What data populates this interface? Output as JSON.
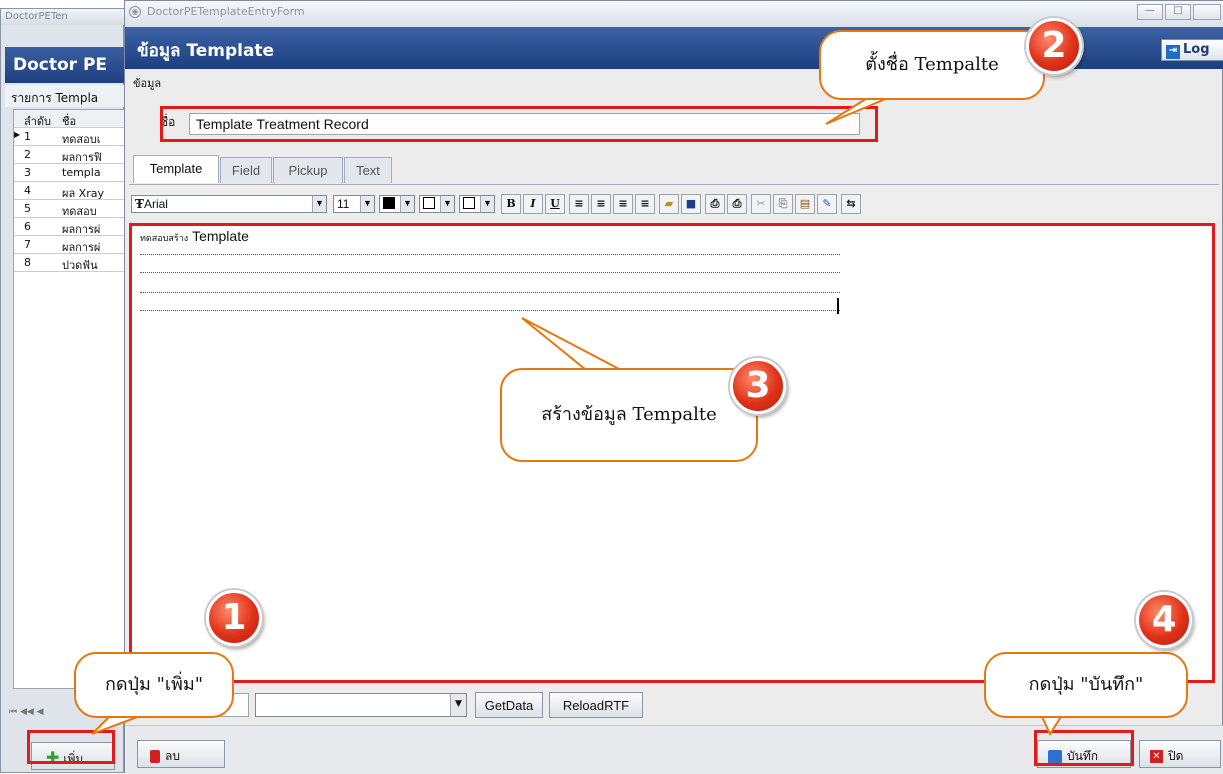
{
  "bg_window": {
    "title": "DoctorPETen",
    "header": "Doctor PE",
    "subheader": "รายการ Templa",
    "columns": [
      "ลำดับ",
      "ชื่อ"
    ],
    "rows": [
      {
        "no": "1",
        "name": "ทดสอบเ"
      },
      {
        "no": "2",
        "name": "ผลการฟิ"
      },
      {
        "no": "3",
        "name": "templa"
      },
      {
        "no": "4",
        "name": "ผล Xray"
      },
      {
        "no": "5",
        "name": "ทดสอบ"
      },
      {
        "no": "6",
        "name": "ผลการผ่"
      },
      {
        "no": "7",
        "name": "ผลการผ่"
      },
      {
        "no": "8",
        "name": "ปวดฟัน"
      }
    ],
    "nav": "⏮ ◀◀ ◀",
    "add_label": "เพิ่ม"
  },
  "window": {
    "title": "DoctorPETemplateEntryForm",
    "header_title": "ข้อมูล Template",
    "logout_label": "Log",
    "section_label": "ข้อมูล"
  },
  "form": {
    "name_label": "ชื่อ",
    "name_value": "Template Treatment Record"
  },
  "tabs": [
    "Template",
    "Field",
    "Pickup",
    "Text"
  ],
  "toolbar": {
    "font": "Arial",
    "font_size": "11",
    "bold": "B",
    "italic": "I",
    "underline": "U"
  },
  "editor": {
    "title_th": "ทดสอบสร้าง",
    "title_en": "Template"
  },
  "bottom": {
    "getdata_label": "GetData",
    "reload_label": "ReloadRTF",
    "delete_label": "ลบ",
    "save_label": "บันทึก",
    "close_label": "ปิด"
  },
  "annotations": {
    "step1_num": "1",
    "step1_text": "กดปุ่ม \"เพิ่ม\"",
    "step2_num": "2",
    "step2_text": "ตั้งชื่อ Tempalte",
    "step3_num": "3",
    "step3_text": "สร้างข้อมูล Tempalte",
    "step4_num": "4",
    "step4_text": "กดปุ่ม \"บันทึก\""
  },
  "colors": {
    "header_blue": "#1c3e7f",
    "annotation_red": "#e21a1a",
    "callout_orange": "#e8760f"
  }
}
